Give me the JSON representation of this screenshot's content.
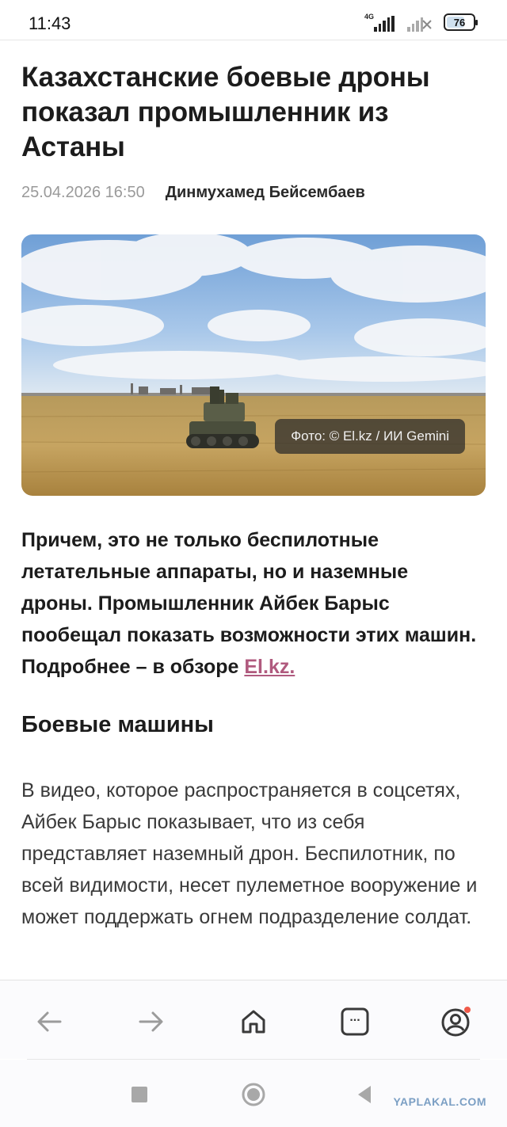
{
  "status_bar": {
    "time": "11:43",
    "network_label": "4G",
    "battery": "76"
  },
  "article": {
    "title": "Казахстанские боевые дроны показал промышленник из Астаны",
    "date": "25.04.2026 16:50",
    "author": "Динмухамед Бейсембаев",
    "photo_caption": "Фото: © El.kz / ИИ Gemini",
    "lead_text": "Причем, это не только беспилотные летательные аппараты, но и наземные дроны. Промышленник Айбек Барыс пообещал показать возможности этих машин. Подробнее – в обзоре ",
    "lead_link": "El.kz.",
    "section_heading": "Боевые машины",
    "body_text": "В видео, которое распространяется в соцсетях, Айбек Барыс показывает, что из себя представляет наземный дрон. Беспилотник, по всей видимости, несет пулеметное вооружение и может поддержать огнем подразделение солдат."
  },
  "browser_nav": {
    "items": [
      "back-icon",
      "forward-icon",
      "home-icon",
      "tabs-icon",
      "profile-icon"
    ],
    "tabs_label": "...",
    "notification_color": "#f05a4a"
  },
  "system_nav": {
    "items": [
      "recents-icon",
      "home-circle-icon",
      "back-triangle-icon"
    ]
  },
  "watermark": "YAPLAKAL.COM",
  "colors": {
    "link": "#b05a7e",
    "meta_date": "#9a9a9a"
  }
}
